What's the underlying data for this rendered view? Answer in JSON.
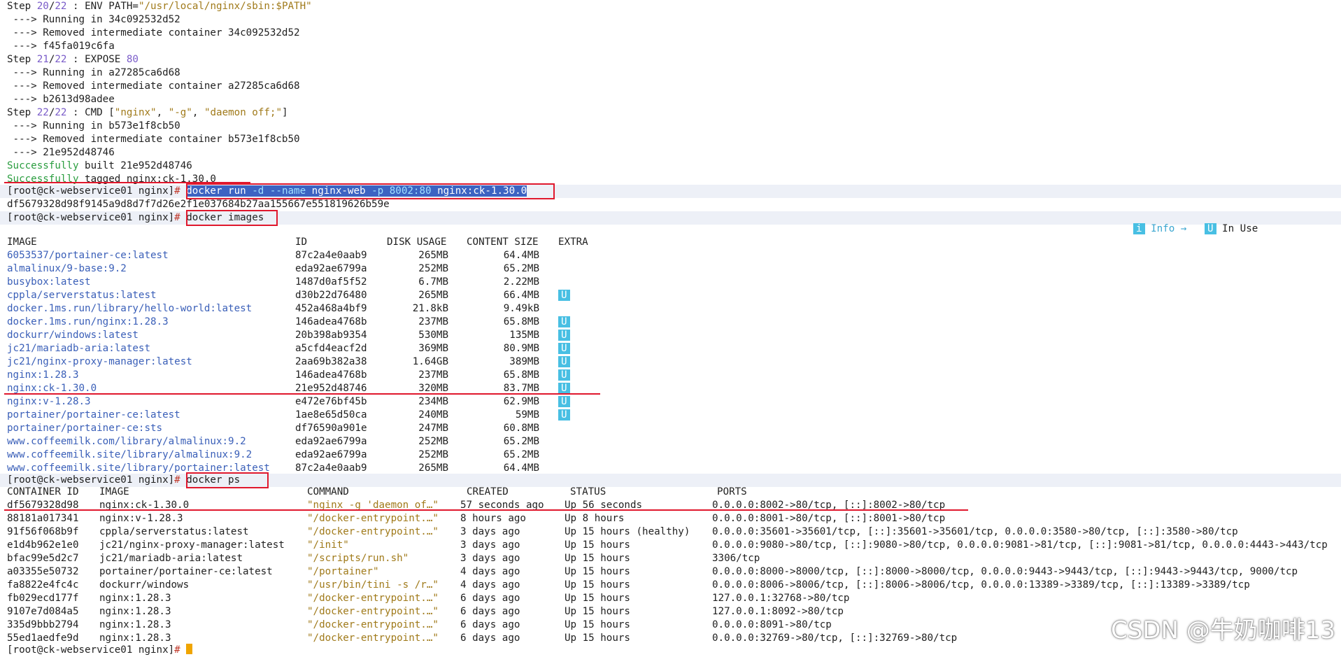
{
  "build": {
    "step20": {
      "prefix": "Step ",
      "num": "20",
      "sep": "/",
      "total": "22",
      "rest": " : ENV PATH=",
      "path": "\"/usr/local/nginx/sbin:$PATH\""
    },
    "run20": " ---> Running in 34c092532d52",
    "rm20": " ---> Removed intermediate container 34c092532d52",
    "id20": " ---> f45fa019c6fa",
    "step21": {
      "prefix": "Step ",
      "num": "21",
      "sep": "/",
      "total": "22",
      "rest": " : EXPOSE ",
      "port": "80"
    },
    "run21": " ---> Running in a27285ca6d68",
    "rm21": " ---> Removed intermediate container a27285ca6d68",
    "id21": " ---> b2613d98adee",
    "step22": {
      "prefix": "Step ",
      "num": "22",
      "sep": "/",
      "total": "22",
      "rest": " : CMD [",
      "a1": "\"nginx\"",
      "c1": ", ",
      "a2": "\"-g\"",
      "c2": ", ",
      "a3": "\"daemon off;\"",
      "end": "]"
    },
    "run22": " ---> Running in b573e1f8cb50",
    "rm22": " ---> Removed intermediate container b573e1f8cb50",
    "id22": " ---> 21e952d48746",
    "built_ok": "Successfully",
    "built_rest": " built 21e952d48746",
    "tagged_ok": "Successfully",
    "tagged_rest": " tagged nginx:ck-1.30.0"
  },
  "prompt": {
    "text": "[root@ck-webservice01 nginx]",
    "char": "#"
  },
  "cmd_run": {
    "p1": "docker run ",
    "flag1": "-d",
    "p2": " ",
    "flag2": "--name",
    "p3": " nginx-web ",
    "flag3": "-p",
    "p4": " ",
    "port": "8002:80",
    "p5": " nginx:ck-1.30.0"
  },
  "run_output": "df5679328d98f9145a9d8d7f7d26e2f1e037684b27aa155667e551819626b59e",
  "cmd_images": "docker images",
  "legend": {
    "info_badge": "i",
    "info_label": " Info →",
    "use_badge": "U",
    "use_label": " In Use"
  },
  "images": {
    "headers": {
      "image": "IMAGE",
      "id": "ID",
      "disk": "DISK USAGE",
      "content": "CONTENT SIZE",
      "extra": "EXTRA"
    },
    "rows": [
      {
        "image": "6053537/portainer-ce:latest",
        "id": "87c2a4e0aab9",
        "disk": "265MB",
        "content": "64.4MB",
        "extra": ""
      },
      {
        "image": "almalinux/9-base:9.2",
        "id": "eda92ae6799a",
        "disk": "252MB",
        "content": "65.2MB",
        "extra": ""
      },
      {
        "image": "busybox:latest",
        "id": "1487d0af5f52",
        "disk": "6.7MB",
        "content": "2.22MB",
        "extra": ""
      },
      {
        "image": "cppla/serverstatus:latest",
        "id": "d30b22d76480",
        "disk": "265MB",
        "content": "66.4MB",
        "extra": "U"
      },
      {
        "image": "docker.1ms.run/library/hello-world:latest",
        "id": "452a468a4bf9",
        "disk": "21.8kB",
        "content": "9.49kB",
        "extra": ""
      },
      {
        "image": "docker.1ms.run/nginx:1.28.3",
        "id": "146adea4768b",
        "disk": "237MB",
        "content": "65.8MB",
        "extra": "U"
      },
      {
        "image": "dockurr/windows:latest",
        "id": "20b398ab9354",
        "disk": "530MB",
        "content": "135MB",
        "extra": "U"
      },
      {
        "image": "jc21/mariadb-aria:latest",
        "id": "a5cfd4eacf2d",
        "disk": "369MB",
        "content": "80.9MB",
        "extra": "U"
      },
      {
        "image": "jc21/nginx-proxy-manager:latest",
        "id": "2aa69b382a38",
        "disk": "1.64GB",
        "content": "389MB",
        "extra": "U"
      },
      {
        "image": "nginx:1.28.3",
        "id": "146adea4768b",
        "disk": "237MB",
        "content": "65.8MB",
        "extra": "U"
      },
      {
        "image": "nginx:ck-1.30.0",
        "id": "21e952d48746",
        "disk": "320MB",
        "content": "83.7MB",
        "extra": "U"
      },
      {
        "image": "nginx:v-1.28.3",
        "id": "e472e76bf45b",
        "disk": "234MB",
        "content": "62.9MB",
        "extra": "U"
      },
      {
        "image": "portainer/portainer-ce:latest",
        "id": "1ae8e65d50ca",
        "disk": "240MB",
        "content": "59MB",
        "extra": "U"
      },
      {
        "image": "portainer/portainer-ce:sts",
        "id": "df76590a901e",
        "disk": "247MB",
        "content": "60.8MB",
        "extra": ""
      },
      {
        "image": "www.coffeemilk.com/library/almalinux:9.2",
        "id": "eda92ae6799a",
        "disk": "252MB",
        "content": "65.2MB",
        "extra": ""
      },
      {
        "image": "www.coffeemilk.site/library/almalinux:9.2",
        "id": "eda92ae6799a",
        "disk": "252MB",
        "content": "65.2MB",
        "extra": ""
      },
      {
        "image": "www.coffeemilk.site/library/portainer:latest",
        "id": "87c2a4e0aab9",
        "disk": "265MB",
        "content": "64.4MB",
        "extra": ""
      }
    ]
  },
  "cmd_ps": "docker ps",
  "ps": {
    "headers": {
      "cid": "CONTAINER ID",
      "image": "IMAGE",
      "command": "COMMAND",
      "created": "CREATED",
      "status": "STATUS",
      "ports": "PORTS"
    },
    "rows": [
      {
        "cid": "df5679328d98",
        "image": "nginx:ck-1.30.0",
        "command": "\"nginx -g 'daemon of…\"",
        "created": "57 seconds ago",
        "status": "Up 56 seconds",
        "ports": "0.0.0.0:8002->80/tcp, [::]:8002->80/tcp"
      },
      {
        "cid": "88181a017341",
        "image": "nginx:v-1.28.3",
        "command": "\"/docker-entrypoint.…\"",
        "created": "8 hours ago",
        "status": "Up 8 hours",
        "ports": "0.0.0.0:8001->80/tcp, [::]:8001->80/tcp"
      },
      {
        "cid": "91f56f068b9f",
        "image": "cppla/serverstatus:latest",
        "command": "\"/docker-entrypoint.…\"",
        "created": "3 days ago",
        "status": "Up 15 hours (healthy)",
        "ports": "0.0.0.0:35601->35601/tcp, [::]:35601->35601/tcp, 0.0.0.0:3580->80/tcp, [::]:3580->80/tcp"
      },
      {
        "cid": "e1d4b962e1e0",
        "image": "jc21/nginx-proxy-manager:latest",
        "command": "\"/init\"",
        "created": "3 days ago",
        "status": "Up 15 hours",
        "ports": "0.0.0.0:9080->80/tcp, [::]:9080->80/tcp, 0.0.0.0:9081->81/tcp, [::]:9081->81/tcp, 0.0.0.0:4443->443/tcp"
      },
      {
        "cid": "bfac99e5d2c7",
        "image": "jc21/mariadb-aria:latest",
        "command": "\"/scripts/run.sh\"",
        "created": "3 days ago",
        "status": "Up 15 hours",
        "ports": "3306/tcp"
      },
      {
        "cid": "a03355e50732",
        "image": "portainer/portainer-ce:latest",
        "command": "\"/portainer\"",
        "created": "4 days ago",
        "status": "Up 15 hours",
        "ports": "0.0.0.0:8000->8000/tcp, [::]:8000->8000/tcp, 0.0.0.0:9443->9443/tcp, [::]:9443->9443/tcp, 9000/tcp"
      },
      {
        "cid": "fa8822e4fc4c",
        "image": "dockurr/windows",
        "command": "\"/usr/bin/tini -s /r…\"",
        "created": "4 days ago",
        "status": "Up 15 hours",
        "ports": "0.0.0.0:8006->8006/tcp, [::]:8006->8006/tcp, 0.0.0.0:13389->3389/tcp, [::]:13389->3389/tcp"
      },
      {
        "cid": "fb029ecd177f",
        "image": "nginx:1.28.3",
        "command": "\"/docker-entrypoint.…\"",
        "created": "6 days ago",
        "status": "Up 15 hours",
        "ports": "127.0.0.1:32768->80/tcp"
      },
      {
        "cid": "9107e7d084a5",
        "image": "nginx:1.28.3",
        "command": "\"/docker-entrypoint.…\"",
        "created": "6 days ago",
        "status": "Up 15 hours",
        "ports": "127.0.0.1:8092->80/tcp"
      },
      {
        "cid": "335d9bbb2794",
        "image": "nginx:1.28.3",
        "command": "\"/docker-entrypoint.…\"",
        "created": "6 days ago",
        "status": "Up 15 hours",
        "ports": "0.0.0.0:8091->80/tcp"
      },
      {
        "cid": "55ed1aedfe9d",
        "image": "nginx:1.28.3",
        "command": "\"/docker-entrypoint.…\"",
        "created": "6 days ago",
        "status": "Up 15 hours",
        "ports": "0.0.0.0:32769->80/tcp, [::]:32769->80/tcp"
      }
    ]
  },
  "watermark": "CSDN @牛奶咖啡13",
  "colors": {
    "annotation": "#e0182d",
    "selection": "#3c63c2",
    "badge": "#48bfe3",
    "success": "#2a9d3f",
    "image_name": "#3a5fb8"
  }
}
